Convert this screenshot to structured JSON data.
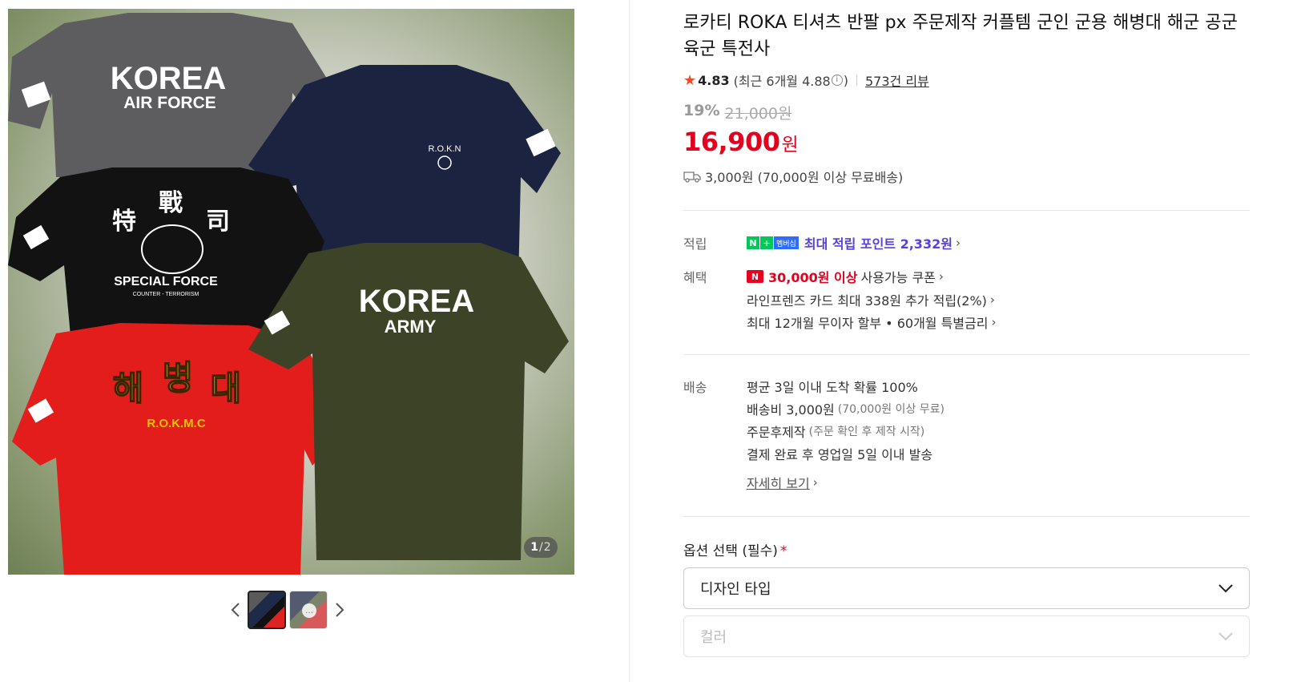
{
  "gallery": {
    "counter_current": "1",
    "counter_total": "2",
    "shirts": {
      "airforce": {
        "line1": "KOREA",
        "line2": "AIR FORCE"
      },
      "navy": {
        "text": "R.O.K.N"
      },
      "special": {
        "hanja": [
          "特",
          "戰",
          "司"
        ],
        "line1": "SPECIAL FORCE",
        "line2": "COUNTER - TERRORISM"
      },
      "army": {
        "line1": "KOREA",
        "line2": "ARMY"
      },
      "marine": {
        "hangul": [
          "해",
          "병",
          "대"
        ],
        "line1": "R.O.K.M.C"
      }
    }
  },
  "product": {
    "title": "로카티 ROKA 티셔츠 반팔 px 주문제작 커플템 군인 군용 해병대 해군 공군 육군 특전사",
    "rating": "4.83",
    "rating_recent_prefix": "(최근 6개월 4.88",
    "rating_recent_suffix": ")",
    "review_count": "573건 리뷰",
    "discount_rate": "19%",
    "original_price": "21,000원",
    "price": "16,900",
    "price_unit": "원",
    "shipping": "3,000원 (70,000원 이상 무료배송)"
  },
  "points": {
    "label": "적립",
    "badge_n": "N",
    "badge_plus": "+",
    "badge_membership": "멤버십",
    "text": "최대 적립 포인트 2,332원"
  },
  "benefits": {
    "label": "혜택",
    "badge": "N",
    "coupon_amount": "30,000원 이상",
    "coupon_text": "사용가능 쿠폰",
    "card": "라인프렌즈 카드 최대 338원 추가 적립(2%)",
    "installment": "최대 12개월 무이자 할부 • 60개월 특별금리"
  },
  "delivery": {
    "label": "배송",
    "line1": "평균 3일 이내 도착 확률 100%",
    "line2": "배송비 3,000원",
    "line2_note": "(70,000원 이상 무료)",
    "line3": "주문후제작",
    "line3_note": "(주문 확인 후 제작 시작)",
    "line4": "결제 완료 후 영업일 5일 이내 발송",
    "detail_link": "자세히 보기"
  },
  "options": {
    "label": "옵션 선택 (필수)",
    "required_mark": "*",
    "select1_placeholder": "디자인 타입",
    "select2_placeholder": "컬러"
  }
}
